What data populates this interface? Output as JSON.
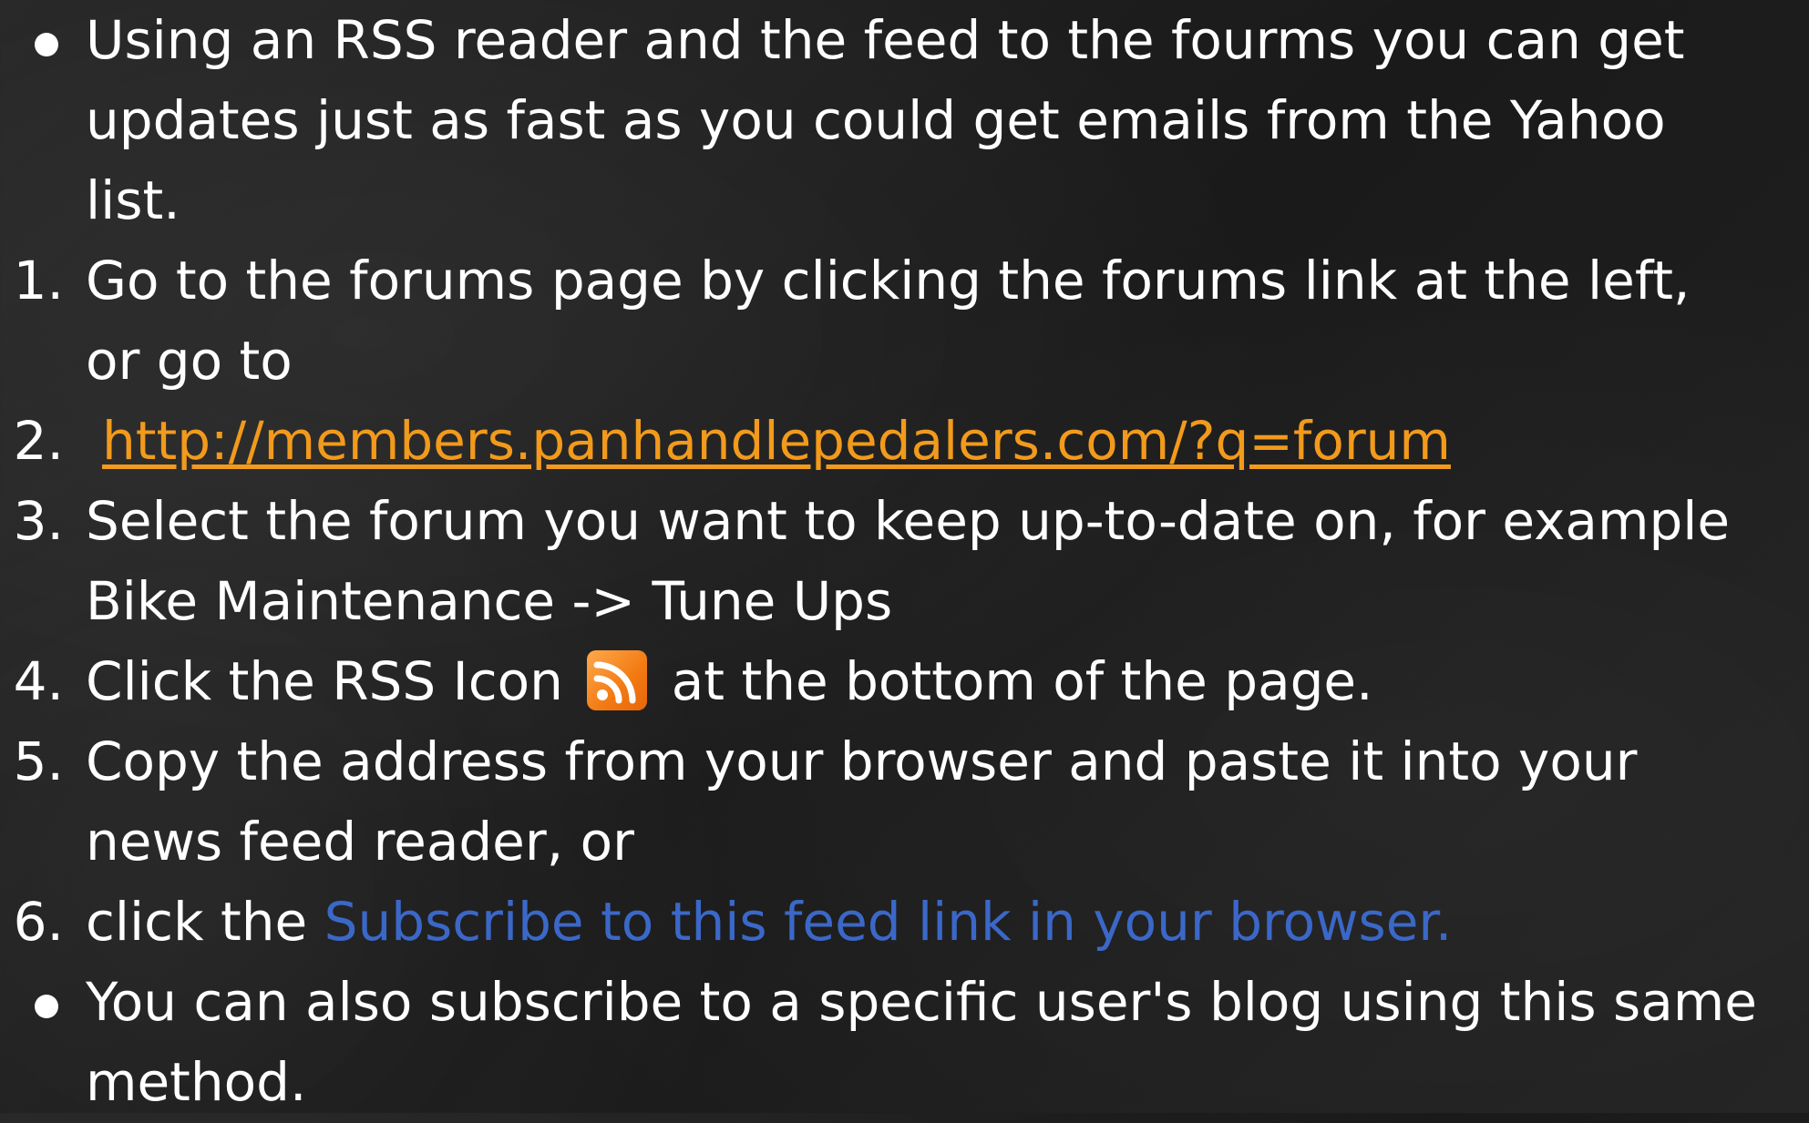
{
  "list": {
    "intro_bullet": {
      "marker": "•",
      "text": "Using an RSS reader and the feed to the fourms you can get"
    },
    "intro_cont1": "updates just as fast as you could get emails from the Yahoo",
    "intro_cont2": "list.",
    "steps": [
      {
        "marker": "1.",
        "text": "Go to the forums page by clicking the forums link at the left,",
        "cont": "or go to"
      },
      {
        "marker": "2.",
        "link": "http://members.panhandlepedalers.com/?q=forum"
      },
      {
        "marker": "3.",
        "text": "Select the forum you want to keep up-to-date on, for example",
        "cont": "Bike Maintenance -> Tune Ups"
      },
      {
        "marker": "4.",
        "before_icon": "Click the RSS Icon",
        "icon": "rss-feed-icon",
        "after_icon": "at the bottom of the page."
      },
      {
        "marker": "5.",
        "text": "Copy the address from your browser and paste it into your",
        "cont": "news feed reader, or"
      },
      {
        "marker": "6.",
        "prefix": "click the ",
        "link": "Subscribe to this feed link in your browser."
      }
    ],
    "outro_bullet": {
      "marker": "•",
      "text": "You can also subscribe to a specific user's blog using this same"
    },
    "outro_cont": "method."
  },
  "colors": {
    "background": "#1e1e1e",
    "text": "#ffffff",
    "forum_link": "#f29a1c",
    "subscribe_link": "#3b68c8",
    "rss_icon": "#f27a12"
  }
}
